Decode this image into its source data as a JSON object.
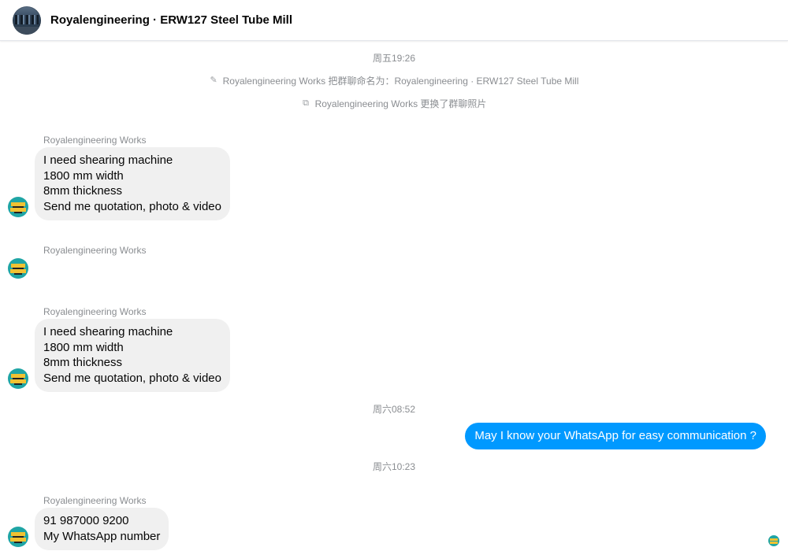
{
  "header": {
    "title": "Royalengineering · ERW127 Steel Tube Mill",
    "avatar_icon": "group-photo-avatar"
  },
  "timeline": {
    "time_1": "周五19:26",
    "sys_1": {
      "icon": "pencil-icon",
      "text": "Royalengineering Works 把群聊命名为：Royalengineering · ERW127 Steel Tube Mill"
    },
    "sys_2": {
      "icon": "photo-icon",
      "text": "Royalengineering Works 更换了群聊照片"
    },
    "time_2": "周六08:52",
    "time_3": "周六10:23"
  },
  "messages": [
    {
      "sender": "Royalengineering Works",
      "lines": [
        "I need shearing machine",
        "1800 mm width",
        "8mm thickness",
        "Send me quotation, photo & video"
      ]
    },
    {
      "sender": "Royalengineering Works",
      "lines": []
    },
    {
      "sender": "Royalengineering Works",
      "lines": [
        "I need shearing machine",
        "1800 mm width",
        "8mm thickness",
        "Send me quotation, photo & video"
      ]
    },
    {
      "outgoing": true,
      "text": "May I know your WhatsApp for easy communication ?"
    },
    {
      "sender": "Royalengineering Works",
      "lines": [
        "91 987000 9200",
        "My WhatsApp number"
      ]
    }
  ],
  "colors": {
    "outgoing_bubble": "#0099ff",
    "incoming_bubble": "#f0f0f0",
    "meta_text": "#8a8d91"
  }
}
